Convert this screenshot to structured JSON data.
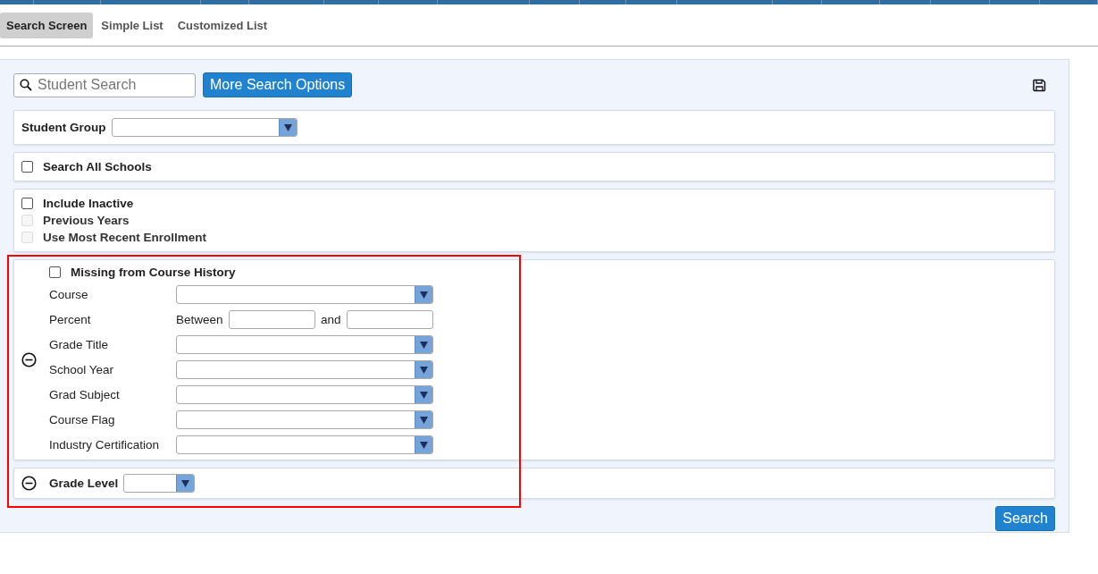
{
  "tabs": [
    {
      "label": "Search Screen",
      "selected": true
    },
    {
      "label": "Simple List",
      "selected": false
    },
    {
      "label": "Customized List",
      "selected": false
    }
  ],
  "search": {
    "placeholder": "Student Search",
    "button": "More Search Options"
  },
  "student_group": {
    "label": "Student Group"
  },
  "search_all_schools": {
    "label": "Search All Schools",
    "checked": false,
    "disabled": false
  },
  "enrollment_options": [
    {
      "label": "Include Inactive",
      "checked": false,
      "disabled": false
    },
    {
      "label": "Previous Years",
      "checked": false,
      "disabled": true
    },
    {
      "label": "Use Most Recent Enrollment",
      "checked": false,
      "disabled": true
    }
  ],
  "course_history": {
    "highlighted": true,
    "expanded": true,
    "missing": {
      "label": "Missing from Course History",
      "checked": false,
      "disabled": false
    },
    "fields": [
      {
        "kind": "dropdown",
        "label": "Course"
      },
      {
        "kind": "range",
        "label": "Percent",
        "from_label": "Between",
        "to_label": "and"
      },
      {
        "kind": "dropdown",
        "label": "Grade Title"
      },
      {
        "kind": "dropdown",
        "label": "School Year"
      },
      {
        "kind": "dropdown",
        "label": "Grad Subject"
      },
      {
        "kind": "dropdown",
        "label": "Course Flag"
      },
      {
        "kind": "dropdown",
        "label": "Industry Certification"
      }
    ]
  },
  "grade_level": {
    "label": "Grade Level",
    "expanded": true
  },
  "submit": {
    "label": "Search"
  }
}
